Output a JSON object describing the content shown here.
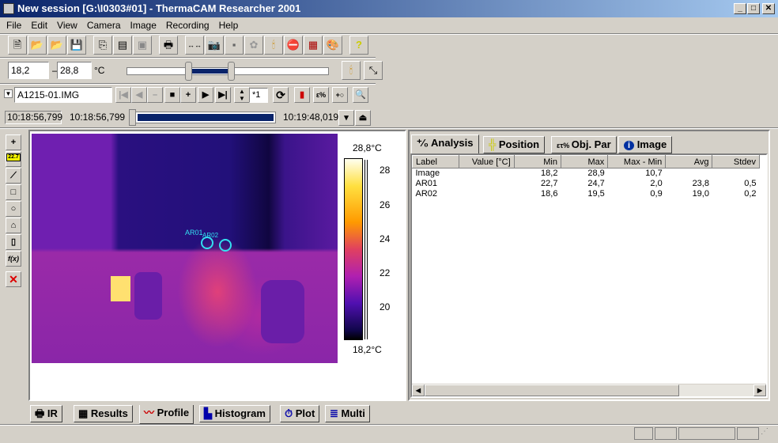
{
  "window": {
    "title": "New session [G:\\I0303#01] - ThermaCAM Researcher  2001",
    "min": "_",
    "max": "□",
    "close": "✕"
  },
  "menu": [
    "File",
    "Edit",
    "View",
    "Camera",
    "Image",
    "Recording",
    "Help"
  ],
  "range": {
    "min": "18,2",
    "max": "28,8",
    "dash": "–",
    "unit": "°C",
    "slider_low_fraction": 0.3,
    "slider_high_fraction": 0.52
  },
  "sequence": {
    "file": "A1215-01.IMG",
    "step": "*1",
    "current_time": "10:18:56,799",
    "start_time": "10:18:56,799",
    "end_time": "10:19:48,019",
    "position_fraction": 0.0
  },
  "image": {
    "scale_max": "28,8°C",
    "scale_min": "18,2°C",
    "ticks": [
      "28",
      "26",
      "24",
      "22",
      "20"
    ],
    "areas": [
      "AR01",
      "AR02"
    ],
    "colors": {
      "cursor": "#33e0f0"
    }
  },
  "analysis": {
    "tabs": [
      "Analysis",
      "Position",
      "Obj. Par",
      "Image"
    ],
    "columns": [
      "Label",
      "Value [°C]",
      "Min",
      "Max",
      "Max - Min",
      "Avg",
      "Stdev"
    ],
    "rows": [
      [
        "Image",
        "",
        "18,2",
        "28,9",
        "10,7",
        "",
        ""
      ],
      [
        "AR01",
        "",
        "22,7",
        "24,7",
        "2,0",
        "23,8",
        "0,5"
      ],
      [
        "AR02",
        "",
        "18,6",
        "19,5",
        "0,9",
        "19,0",
        "0,2"
      ]
    ]
  },
  "bottom_tabs": [
    "IR",
    "Results",
    "Profile",
    "Histogram",
    "Plot",
    "Multi"
  ],
  "active_bottom_tab": "Profile",
  "tools": {
    "spot_value": "22.7",
    "fx": "f(x)"
  }
}
